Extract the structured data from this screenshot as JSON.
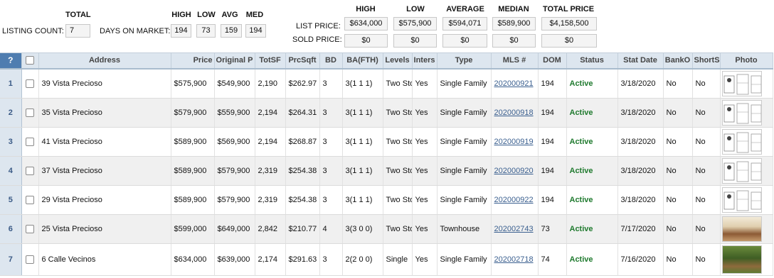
{
  "summary": {
    "total_header": "TOTAL",
    "listing_count_label": "LISTING COUNT:",
    "listing_count": "7",
    "days_headers": [
      "HIGH",
      "LOW",
      "AVG",
      "MED"
    ],
    "days_label": "DAYS ON MARKET:",
    "days_values": [
      "194",
      "73",
      "159",
      "194"
    ],
    "price_headers": [
      "HIGH",
      "LOW",
      "AVERAGE",
      "MEDIAN",
      "TOTAL PRICE"
    ],
    "list_price_label": "LIST PRICE:",
    "list_prices": [
      "$634,000",
      "$575,900",
      "$594,071",
      "$589,900",
      "$4,158,500"
    ],
    "sold_price_label": "SOLD PRICE:",
    "sold_prices": [
      "$0",
      "$0",
      "$0",
      "$0",
      "$0"
    ]
  },
  "grid": {
    "question_mark": "?",
    "columns": [
      "Address",
      "Price",
      "Original P",
      "TotSF",
      "PrcSqft",
      "BD",
      "BA(FTH)",
      "Levels",
      "Inters",
      "Type",
      "MLS #",
      "DOM",
      "Status",
      "Stat Date",
      "BankO",
      "ShortS",
      "Photo"
    ],
    "rows": [
      {
        "num": "1",
        "address": "39 Vista Precioso",
        "price": "$575,900",
        "orig": "$549,900",
        "totsf": "2,190",
        "prcsqft": "$262.97",
        "bd": "3",
        "ba": "3(1 1 1)",
        "levels": "Two Sto",
        "inters": "Yes",
        "type": "Single Family",
        "mls": "202000921",
        "dom": "194",
        "status": "Active",
        "statdate": "3/18/2020",
        "banko": "No",
        "shorts": "No",
        "photo": "floorplan"
      },
      {
        "num": "2",
        "address": "35 Vista Precioso",
        "price": "$579,900",
        "orig": "$559,900",
        "totsf": "2,194",
        "prcsqft": "$264.31",
        "bd": "3",
        "ba": "3(1 1 1)",
        "levels": "Two Sto",
        "inters": "Yes",
        "type": "Single Family",
        "mls": "202000918",
        "dom": "194",
        "status": "Active",
        "statdate": "3/18/2020",
        "banko": "No",
        "shorts": "No",
        "photo": "floorplan"
      },
      {
        "num": "3",
        "address": "41 Vista Precioso",
        "price": "$589,900",
        "orig": "$569,900",
        "totsf": "2,194",
        "prcsqft": "$268.87",
        "bd": "3",
        "ba": "3(1 1 1)",
        "levels": "Two Sto",
        "inters": "Yes",
        "type": "Single Family",
        "mls": "202000919",
        "dom": "194",
        "status": "Active",
        "statdate": "3/18/2020",
        "banko": "No",
        "shorts": "No",
        "photo": "floorplan"
      },
      {
        "num": "4",
        "address": "37 Vista Precioso",
        "price": "$589,900",
        "orig": "$579,900",
        "totsf": "2,319",
        "prcsqft": "$254.38",
        "bd": "3",
        "ba": "3(1 1 1)",
        "levels": "Two Sto",
        "inters": "Yes",
        "type": "Single Family",
        "mls": "202000920",
        "dom": "194",
        "status": "Active",
        "statdate": "3/18/2020",
        "banko": "No",
        "shorts": "No",
        "photo": "floorplan"
      },
      {
        "num": "5",
        "address": "29 Vista Precioso",
        "price": "$589,900",
        "orig": "$579,900",
        "totsf": "2,319",
        "prcsqft": "$254.38",
        "bd": "3",
        "ba": "3(1 1 1)",
        "levels": "Two Sto",
        "inters": "Yes",
        "type": "Single Family",
        "mls": "202000922",
        "dom": "194",
        "status": "Active",
        "statdate": "3/18/2020",
        "banko": "No",
        "shorts": "No",
        "photo": "floorplan"
      },
      {
        "num": "6",
        "address": "25 Vista Precioso",
        "price": "$599,000",
        "orig": "$649,000",
        "totsf": "2,842",
        "prcsqft": "$210.77",
        "bd": "4",
        "ba": "3(3 0 0)",
        "levels": "Two Sto",
        "inters": "Yes",
        "type": "Townhouse",
        "mls": "202002743",
        "dom": "73",
        "status": "Active",
        "statdate": "7/17/2020",
        "banko": "No",
        "shorts": "No",
        "photo": "interior"
      },
      {
        "num": "7",
        "address": "6 Calle Vecinos",
        "price": "$634,000",
        "orig": "$639,000",
        "totsf": "2,174",
        "prcsqft": "$291.63",
        "bd": "3",
        "ba": "2(2 0 0)",
        "levels": "Single",
        "inters": "Yes",
        "type": "Single Family",
        "mls": "202002718",
        "dom": "74",
        "status": "Active",
        "statdate": "7/16/2020",
        "banko": "No",
        "shorts": "No",
        "photo": "garden"
      }
    ]
  },
  "colors": {
    "header_bg": "#dde6ef",
    "question_bg": "#4f7db0",
    "status_active": "#1f7a2e",
    "link": "#3a5f8f"
  }
}
